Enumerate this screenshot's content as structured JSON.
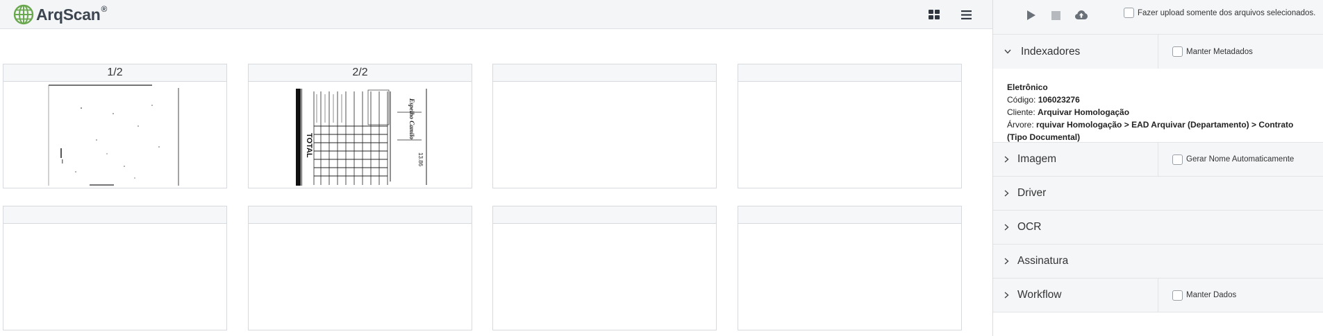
{
  "app": {
    "logo_text": "ArqScan",
    "logo_reg": "®"
  },
  "toolbar": {
    "grid_icon": "grid-view-icon",
    "list_icon": "list-view-icon"
  },
  "pages": [
    {
      "label": "1/2"
    },
    {
      "label": "2/2"
    },
    {
      "label": ""
    },
    {
      "label": ""
    },
    {
      "label": ""
    },
    {
      "label": ""
    },
    {
      "label": ""
    },
    {
      "label": ""
    }
  ],
  "panel": {
    "upload_selected_label": "Fazer upload somente dos arquivos selecionados.",
    "icons": {
      "play": "play-icon",
      "stop": "stop-icon",
      "upload": "cloud-upload-icon"
    },
    "indexadores": {
      "title": "Indexadores",
      "extra_label": "Manter Metadados",
      "type": "Eletrônico",
      "codigo_label": "Código:",
      "codigo_value": "106023276",
      "cliente_label": "Cliente:",
      "cliente_value": "Arquivar Homologação",
      "arvore_label": "Árvore:",
      "arvore_value": "rquivar Homologação > EAD Arquivar (Departamento) > Contrato (Tipo Documental)"
    },
    "imagem": {
      "title": "Imagem",
      "extra_label": "Gerar Nome Automaticamente"
    },
    "driver": {
      "title": "Driver"
    },
    "ocr": {
      "title": "OCR"
    },
    "assinatura": {
      "title": "Assinatura"
    },
    "workflow": {
      "title": "Workflow",
      "extra_label": "Manter Dados"
    }
  },
  "colors": {
    "accent_green": "#6aa84f",
    "text_dark": "#3d4650",
    "panel_bg": "#f5f6f8"
  }
}
